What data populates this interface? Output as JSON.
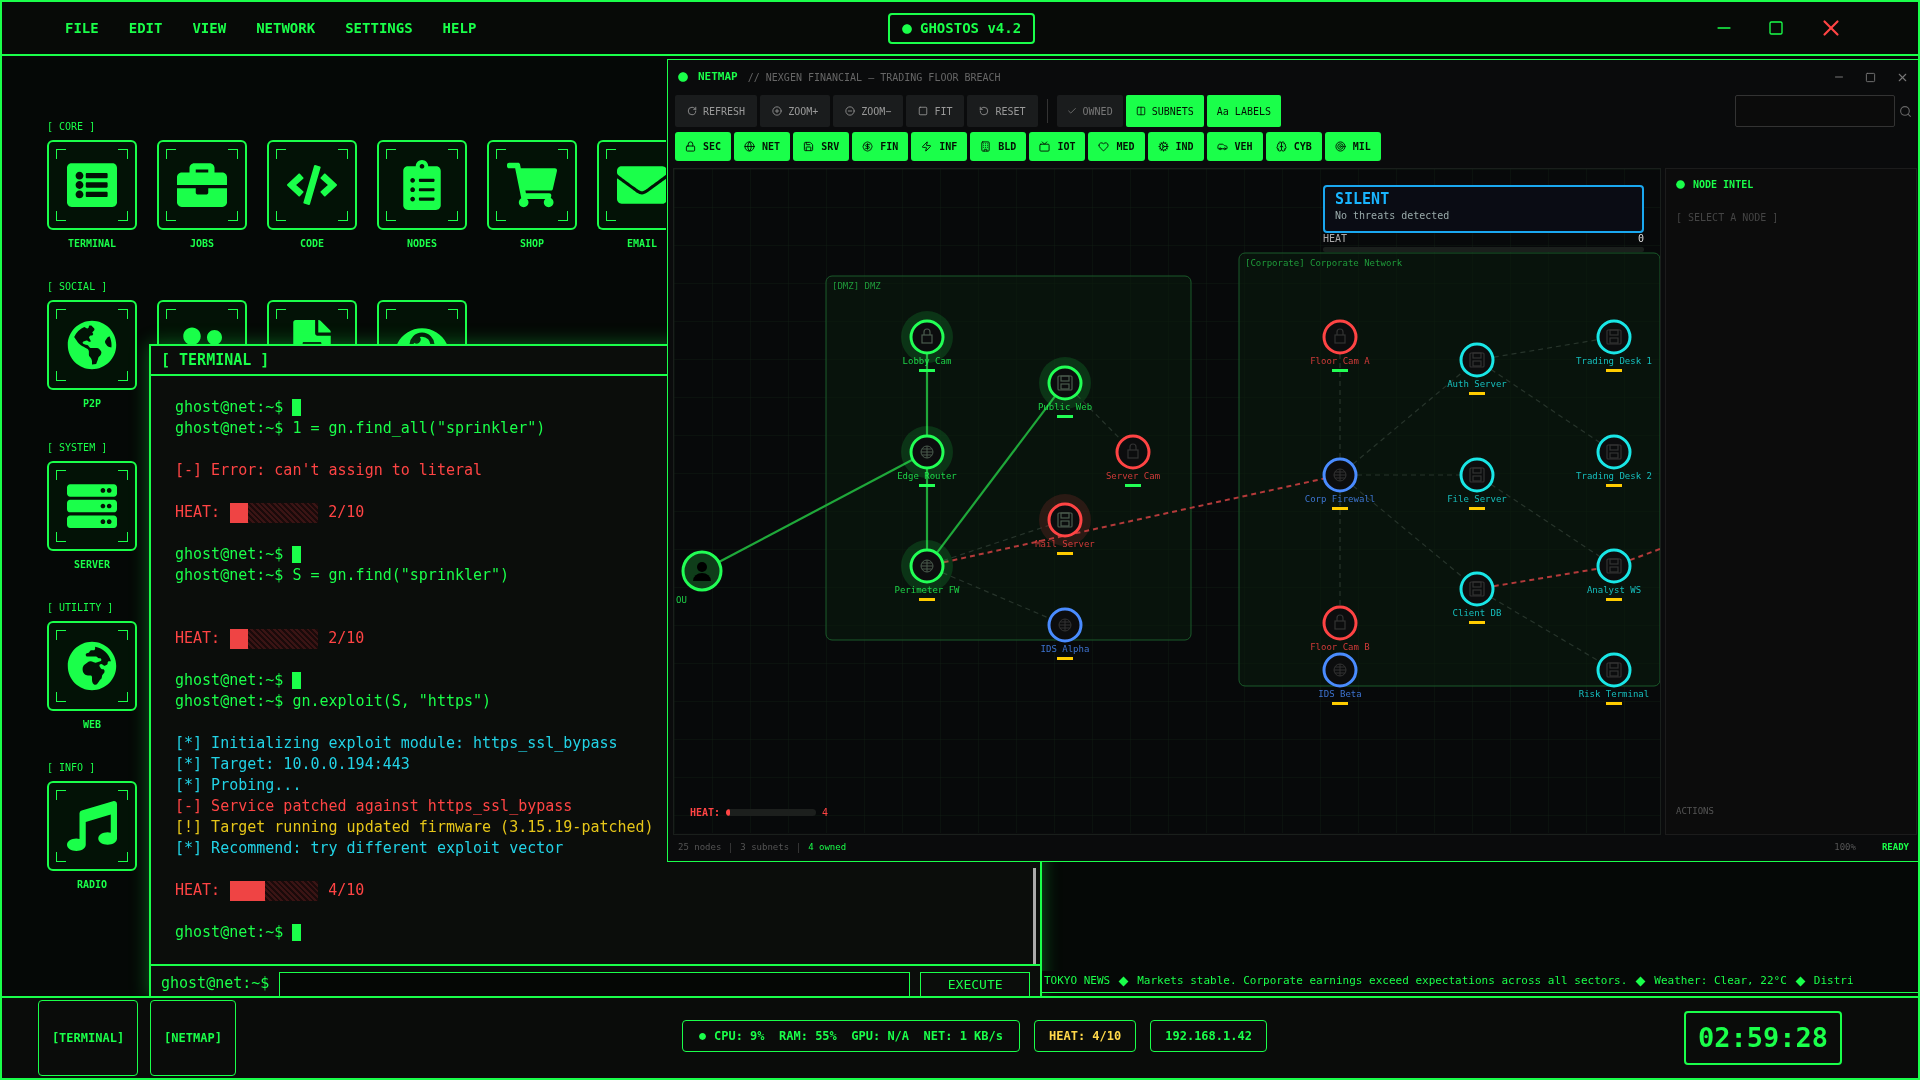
{
  "menu": {
    "items": [
      "FILE",
      "EDIT",
      "VIEW",
      "NETWORK",
      "SETTINGS",
      "HELP"
    ],
    "badge": "GHOSTOS v4.2"
  },
  "desktop": [
    {
      "title": "[ CORE ]",
      "apps": [
        {
          "kind": "terminal",
          "label": "TERMINAL"
        },
        {
          "kind": "jobs",
          "label": "JOBS"
        },
        {
          "kind": "code",
          "label": "CODE"
        },
        {
          "kind": "nodes",
          "label": "NODES"
        },
        {
          "kind": "shop",
          "label": "SHOP"
        },
        {
          "kind": "email",
          "label": "EMAIL"
        }
      ]
    },
    {
      "title": "[ SOCIAL ]",
      "apps": [
        {
          "kind": "p2p",
          "label": "P2P"
        },
        {
          "kind": "people"
        },
        {
          "kind": "file"
        },
        {
          "kind": "eye"
        }
      ]
    },
    {
      "title": "[ SYSTEM ]",
      "apps": [
        {
          "kind": "server",
          "label": "SERVER"
        }
      ]
    },
    {
      "title": "[ UTILITY ]",
      "apps": [
        {
          "kind": "web",
          "label": "WEB"
        }
      ]
    },
    {
      "title": "[ INFO ]",
      "apps": [
        {
          "kind": "radio",
          "label": "RADIO"
        }
      ]
    }
  ],
  "terminal": {
    "title": "[ TERMINAL ]",
    "lines": [
      {
        "kind": "blank"
      },
      {
        "kind": "prompt",
        "prompt": "ghost@net:~$",
        "cursor": true
      },
      {
        "kind": "prompt",
        "prompt": "ghost@net:~$",
        "command": "1 = gn.find_all(\"sprinkler\")"
      },
      {
        "kind": "blank"
      },
      {
        "kind": "error",
        "text": "[-] Error: can't assign to literal"
      },
      {
        "kind": "blank"
      },
      {
        "kind": "heat",
        "label": "HEAT:",
        "level": 0.2,
        "reading": "2/10"
      },
      {
        "kind": "blank"
      },
      {
        "kind": "prompt",
        "prompt": "ghost@net:~$",
        "cursor": true
      },
      {
        "kind": "prompt",
        "prompt": "ghost@net:~$",
        "command": "S = gn.find(\"sprinkler\")"
      },
      {
        "kind": "blank"
      },
      {
        "kind": "blank"
      },
      {
        "kind": "heat",
        "label": "HEAT:",
        "level": 0.2,
        "reading": "2/10"
      },
      {
        "kind": "blank"
      },
      {
        "kind": "prompt",
        "prompt": "ghost@net:~$",
        "cursor": true
      },
      {
        "kind": "prompt",
        "prompt": "ghost@net:~$",
        "command": "gn.exploit(S, \"https\")"
      },
      {
        "kind": "blank"
      },
      {
        "kind": "info",
        "text": "[*] Initializing exploit module: https_ssl_bypass"
      },
      {
        "kind": "info",
        "text": "[*] Target: 10.0.0.194:443"
      },
      {
        "kind": "info",
        "text": "[*] Probing..."
      },
      {
        "kind": "error",
        "text": "[-] Service patched against https_ssl_bypass"
      },
      {
        "kind": "warn",
        "text": "[!] Target running updated firmware (3.15.19-patched)"
      },
      {
        "kind": "info",
        "text": "[*] Recommend: try different exploit vector"
      },
      {
        "kind": "blank"
      },
      {
        "kind": "heat",
        "label": "HEAT:",
        "level": 0.4,
        "reading": "4/10"
      },
      {
        "kind": "blank"
      },
      {
        "kind": "prompt",
        "prompt": "ghost@net:~$",
        "cursor": true
      }
    ],
    "input_prompt": "ghost@net:~$",
    "execute": "EXECUTE"
  },
  "netmap": {
    "title": "NETMAP",
    "subtitle": "// NEXGEN FINANCIAL — TRADING FLOOR BREACH",
    "toolbar": [
      {
        "kind": "refresh",
        "label": "REFRESH"
      },
      {
        "kind": "zoomin",
        "label": "ZOOM+"
      },
      {
        "kind": "zoomout",
        "label": "ZOOM−"
      },
      {
        "kind": "fit",
        "label": "FIT"
      },
      {
        "kind": "reset",
        "label": "RESET"
      }
    ],
    "toggles": [
      {
        "kind": "check",
        "label": "OWNED",
        "on": false
      },
      {
        "kind": "columns",
        "label": "SUBNETS",
        "on": true
      },
      {
        "kind": "text",
        "label": "Aa LABELS",
        "on": true
      }
    ],
    "filters": [
      {
        "kind": "lock",
        "label": "SEC",
        "on": true
      },
      {
        "kind": "globe",
        "label": "NET",
        "on": true
      },
      {
        "kind": "disk",
        "label": "SRV",
        "on": true
      },
      {
        "kind": "money",
        "label": "FIN",
        "on": true
      },
      {
        "kind": "zap",
        "label": "INF",
        "on": true
      },
      {
        "kind": "building",
        "label": "BLD",
        "on": true
      },
      {
        "kind": "tv",
        "label": "IOT",
        "on": true
      },
      {
        "kind": "heart",
        "label": "MED",
        "on": true
      },
      {
        "kind": "cog",
        "label": "IND",
        "on": true
      },
      {
        "kind": "car",
        "label": "VEH",
        "on": true
      },
      {
        "kind": "brain",
        "label": "CYB",
        "on": true
      },
      {
        "kind": "target",
        "label": "MIL",
        "on": true
      }
    ],
    "alert": {
      "title": "SILENT",
      "text": "No threats detected",
      "heat_label": "HEAT",
      "heat_value": "0",
      "level": 0
    },
    "subnets": [
      {
        "label": "[DMZ] DMZ"
      },
      {
        "label": "[Corporate] Corporate Network"
      }
    ],
    "nodes": [
      {
        "label": "OU",
        "color": "#22ff55",
        "kind": "user",
        "halo": false
      },
      {
        "label": "Lobby Cam",
        "color": "#22ff55",
        "kind": "lock",
        "halo": true,
        "marker": {
          "color": "#22ff55"
        }
      },
      {
        "label": "Edge Router",
        "color": "#22ff55",
        "kind": "globe",
        "halo": true,
        "marker": {
          "color": "#22ff55"
        }
      },
      {
        "label": "Perimeter FW",
        "color": "#22ff55",
        "kind": "globe",
        "halo": true,
        "marker": {
          "color": "#ffcc00"
        }
      },
      {
        "label": "Public Web",
        "color": "#22ff55",
        "kind": "disk",
        "halo": true,
        "marker": {
          "color": "#22ff55"
        }
      },
      {
        "label": "Server Cam",
        "color": "#ff4444",
        "kind": "lock",
        "halo": false,
        "marker": {
          "color": "#22ff55"
        }
      },
      {
        "label": "Mail Server",
        "color": "#ff4444",
        "kind": "disk",
        "halo": true,
        "marker": {
          "color": "#ffcc00"
        }
      },
      {
        "label": "IDS Alpha",
        "color": "#4a8cff",
        "kind": "globe",
        "halo": false,
        "marker": {
          "color": "#ffcc00"
        }
      },
      {
        "label": "Floor Cam A",
        "color": "#ff4444",
        "kind": "lock",
        "halo": false,
        "marker": {
          "color": "#22ff55"
        }
      },
      {
        "label": "Auth Server",
        "color": "#19e6e6",
        "kind": "disk",
        "halo": false,
        "marker": {
          "color": "#ffcc00"
        }
      },
      {
        "label": "Trading Desk 1",
        "color": "#19e6e6",
        "kind": "disk",
        "halo": false,
        "marker": {
          "color": "#ffcc00"
        }
      },
      {
        "label": "Corp Firewall",
        "color": "#4a8cff",
        "kind": "globe",
        "halo": false,
        "marker": {
          "color": "#ffcc00"
        }
      },
      {
        "label": "File Server",
        "color": "#19e6e6",
        "kind": "disk",
        "halo": false,
        "marker": {
          "color": "#ffcc00"
        }
      },
      {
        "label": "Trading Desk 2",
        "color": "#19e6e6",
        "kind": "disk",
        "halo": false,
        "marker": {
          "color": "#ffcc00"
        }
      },
      {
        "label": "Client DB",
        "color": "#19e6e6",
        "kind": "disk",
        "halo": false,
        "marker": {
          "color": "#ffcc00"
        }
      },
      {
        "label": "Analyst WS",
        "color": "#19e6e6",
        "kind": "disk",
        "halo": false,
        "marker": {
          "color": "#ffcc00"
        }
      },
      {
        "label": "Floor Cam B",
        "color": "#ff4444",
        "kind": "lock",
        "halo": false
      },
      {
        "label": "IDS Beta",
        "color": "#4a8cff",
        "kind": "globe",
        "halo": false,
        "marker": {
          "color": "#ffcc00"
        }
      },
      {
        "label": "Risk Terminal",
        "color": "#19e6e6",
        "kind": "disk",
        "halo": false,
        "marker": {
          "color": "#ffcc00"
        }
      }
    ],
    "heat": {
      "label": "HEAT:",
      "level": 0.04,
      "reading": "4"
    },
    "intel": {
      "title": "NODE INTEL",
      "placeholder": "[ SELECT A NODE ]",
      "actions": "ACTIONS"
    },
    "footer": {
      "nodes": "25 nodes",
      "subnets": "3 subnets",
      "owned": "4 owned",
      "zoom": "100%",
      "status": "READY"
    }
  },
  "ticker": {
    "source": "TOKYO NEWS",
    "items": [
      "Markets stable. Corporate earnings exceed expectations across all sectors.",
      "Weather: Clear, 22°C",
      "Distri"
    ]
  },
  "taskbar": {
    "windows": [
      "[TERMINAL]",
      "[NETMAP]"
    ],
    "stats": "CPU: 9%  RAM: 55%  GPU: N/A  NET: 1 KB/s",
    "heat": "HEAT: 4/10",
    "ip": "192.168.1.42",
    "clock": "02:59:28"
  }
}
